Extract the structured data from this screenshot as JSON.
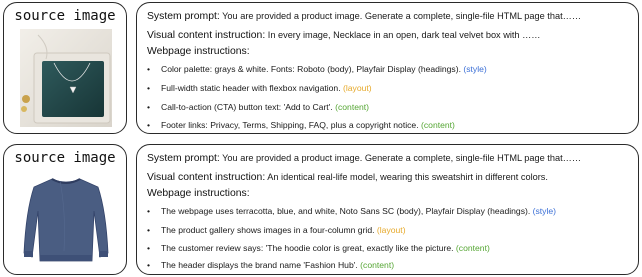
{
  "colors": {
    "style": "#3b6fd6",
    "layout": "#e6a92b",
    "content": "#55a633"
  },
  "examples": [
    {
      "source_label": "source image",
      "image_alt": "necklace-in-teal-velvet-box",
      "system_label": "System prompt:",
      "system_text": " You are provided a product image. Generate a complete, single-file HTML page that……",
      "visual_label": "Visual content instruction:",
      "visual_text": " In every image, Necklace in an open, dark teal velvet box with ……",
      "webpage_label": "Webpage instructions:",
      "bullets": [
        {
          "text": "Color palette: grays & white. Fonts: Roboto (body), Playfair Display (headings). ",
          "tag": "(style)"
        },
        {
          "text": "Full-width static header with flexbox navigation. ",
          "tag": "(layout)"
        },
        {
          "text": "Call-to-action (CTA) button text: 'Add to Cart'. ",
          "tag": "(content)"
        },
        {
          "text": "Footer links: Privacy, Terms, Shipping, FAQ, plus a copyright notice. ",
          "tag": "(content)"
        }
      ]
    },
    {
      "source_label": "source image",
      "image_alt": "navy-sweatshirt",
      "system_label": "System prompt:",
      "system_text": " You are provided a product image. Generate a complete, single-file HTML page that……",
      "visual_label": "Visual content instruction:",
      "visual_text": " An identical real-life model, wearing this sweatshirt in different colors.",
      "webpage_label": "Webpage instructions:",
      "bullets": [
        {
          "text": "The webpage uses terracotta, blue, and white, Noto Sans SC (body), Playfair Display (headings). ",
          "tag": "(style)"
        },
        {
          "text": "The product gallery shows images in a four-column grid. ",
          "tag": "(layout)"
        },
        {
          "text": "The customer review says: 'The hoodie color is great, exactly like the picture. ",
          "tag": "(content)"
        },
        {
          "text": "The header displays the brand name 'Fashion Hub'. ",
          "tag": "(content)"
        }
      ]
    }
  ]
}
